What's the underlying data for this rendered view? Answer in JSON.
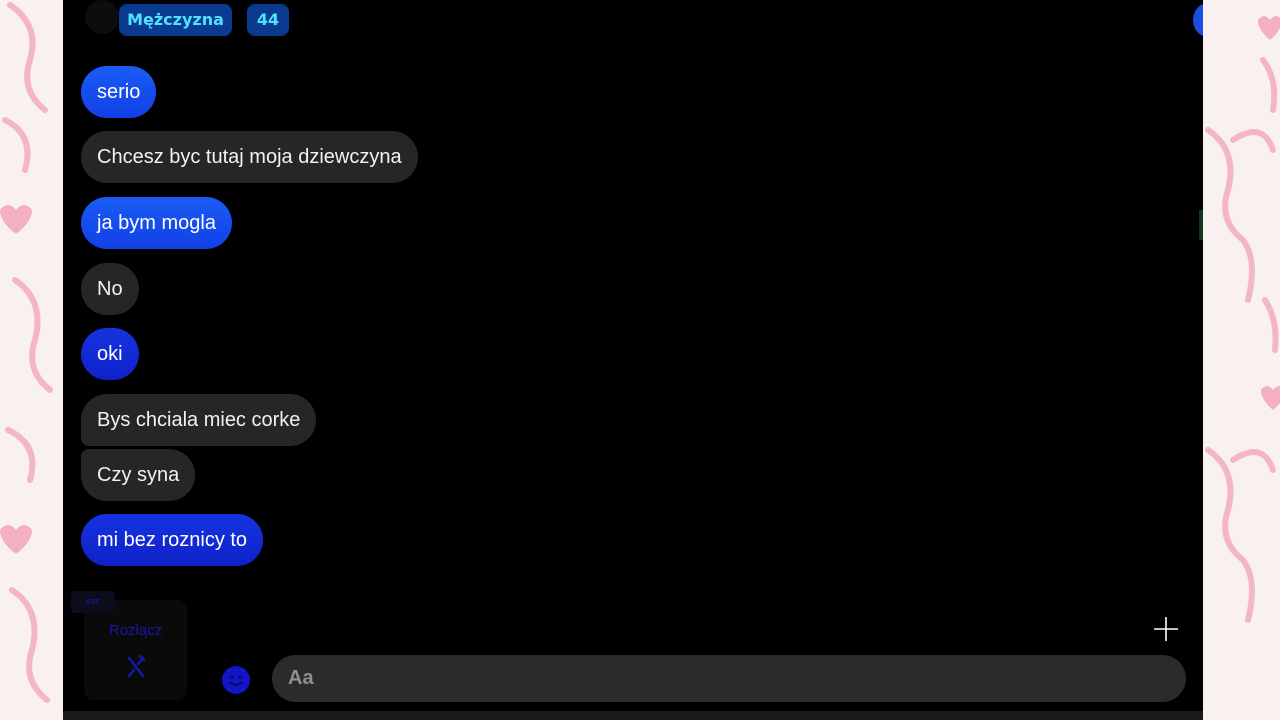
{
  "header": {
    "gender_chip": "Mężczyzna",
    "age_chip": "44"
  },
  "messages": [
    {
      "text": "serio",
      "sender": "me"
    },
    {
      "text": "Chcesz byc tutaj moja dziewczyna",
      "sender": "stranger"
    },
    {
      "text": "ja bym mogla",
      "sender": "me"
    },
    {
      "text": "No",
      "sender": "stranger"
    },
    {
      "text": "oki",
      "sender": "me"
    },
    {
      "text": "Bys chciala miec corke",
      "sender": "stranger"
    },
    {
      "text": "Czy syna",
      "sender": "stranger"
    },
    {
      "text": "mi bez roznicy to",
      "sender": "me"
    }
  ],
  "controls": {
    "disconnect_tag": "esc",
    "disconnect_label": "Rozłącz",
    "input_placeholder": "Aa"
  },
  "colors": {
    "my_bubble": "#1a5cf5",
    "their_bubble": "#262626",
    "chip_bg": "#0b3a91",
    "chip_text": "#4fe2ff",
    "chat_bg": "#000000"
  },
  "icons": {
    "emoji": "emoji-icon",
    "disconnect": "disconnect-icon",
    "cursor": "crosshair-icon"
  }
}
